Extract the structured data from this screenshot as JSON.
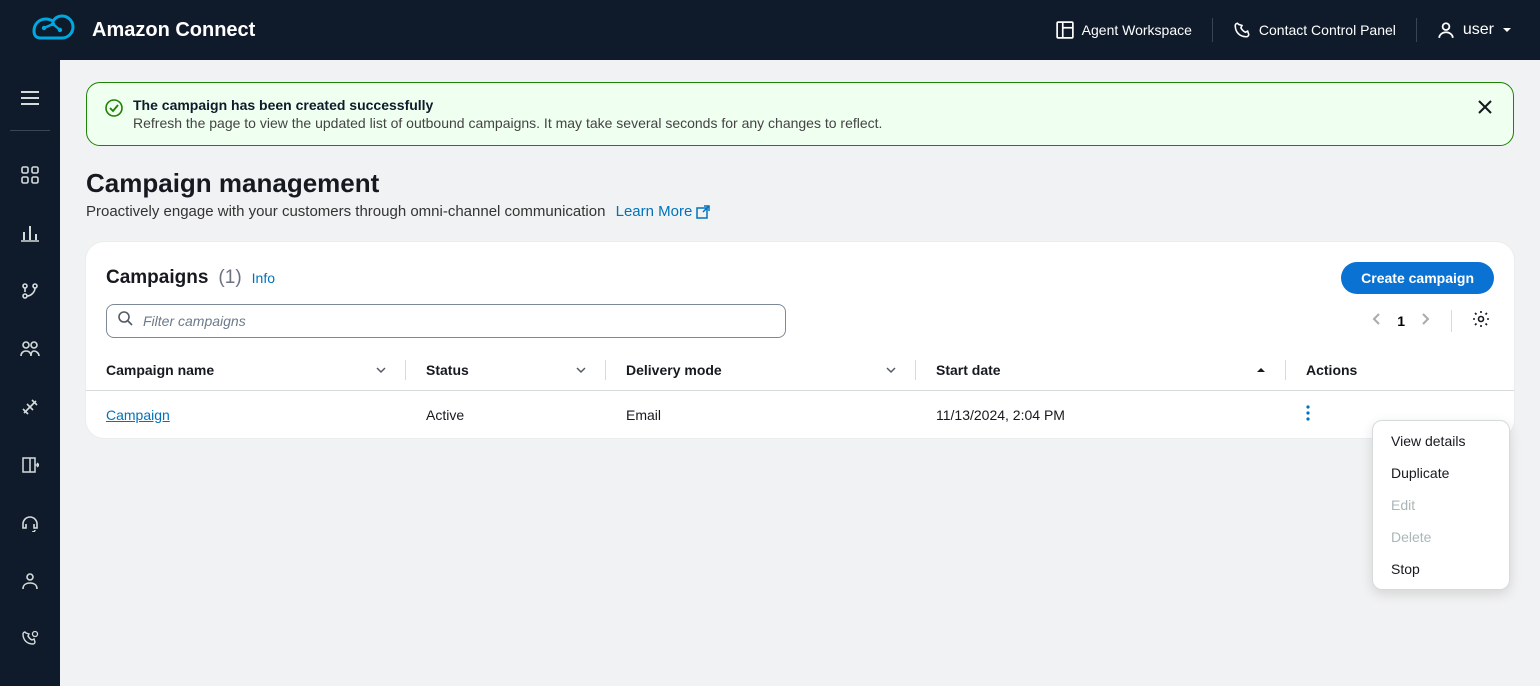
{
  "header": {
    "product_name": "Amazon Connect",
    "agent_workspace": "Agent Workspace",
    "contact_control_panel": "Contact Control Panel",
    "user_label": "user"
  },
  "alert": {
    "title": "The campaign has been created successfully",
    "text": "Refresh the page to view the updated list of outbound campaigns. It may take several seconds for any changes to reflect."
  },
  "page": {
    "title": "Campaign management",
    "subtitle": "Proactively engage with your customers through omni-channel communication",
    "learn_more": "Learn More"
  },
  "card": {
    "title": "Campaigns",
    "count": "(1)",
    "info": "Info",
    "create_label": "Create campaign",
    "filter_placeholder": "Filter campaigns",
    "page_number": "1"
  },
  "table": {
    "headers": {
      "name": "Campaign name",
      "status": "Status",
      "delivery": "Delivery mode",
      "start": "Start date",
      "actions": "Actions"
    },
    "rows": [
      {
        "name": "Campaign",
        "status": "Active",
        "delivery": "Email",
        "start": "11/13/2024, 2:04 PM"
      }
    ]
  },
  "menu": {
    "view_details": "View details",
    "duplicate": "Duplicate",
    "edit": "Edit",
    "delete": "Delete",
    "stop": "Stop"
  }
}
